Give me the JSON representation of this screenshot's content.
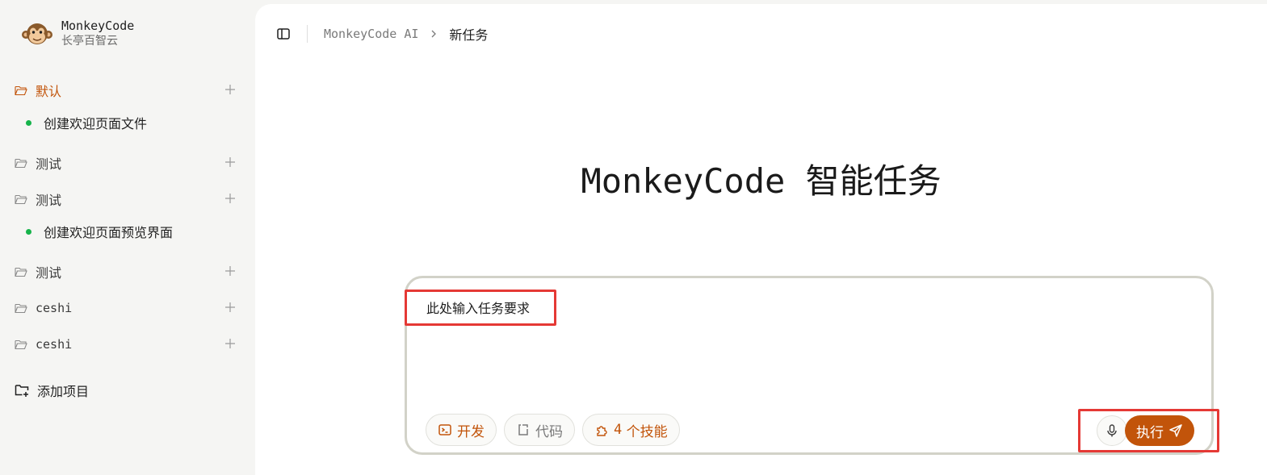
{
  "brand": {
    "name": "MonkeyCode",
    "subtitle": "长亭百智云",
    "logo_icon": "monkey-logo-icon"
  },
  "sidebar": {
    "projects": [
      {
        "label": "默认",
        "active": true,
        "tasks": [
          "创建欢迎页面文件"
        ]
      },
      {
        "label": "测试",
        "active": false,
        "tasks": []
      },
      {
        "label": "测试",
        "active": false,
        "tasks": [
          "创建欢迎页面预览界面"
        ]
      },
      {
        "label": "测试",
        "active": false,
        "tasks": []
      },
      {
        "label": "ceshi",
        "active": false,
        "tasks": []
      },
      {
        "label": "ceshi",
        "active": false,
        "tasks": []
      }
    ],
    "add_project_label": "添加项目"
  },
  "breadcrumb": {
    "root": "MonkeyCode AI",
    "current": "新任务"
  },
  "headline": {
    "latin": "MonkeyCode",
    "cjk": "智能任务"
  },
  "composer": {
    "placeholder": "此处输入任务要求",
    "chips": {
      "dev": "开发",
      "code": "代码",
      "skill_count": "4",
      "skill_suffix": "个技能"
    },
    "run_label": "执行"
  },
  "colors": {
    "accent": "#c2540a",
    "status_dot": "#16b34a",
    "highlight": "#e53935"
  }
}
